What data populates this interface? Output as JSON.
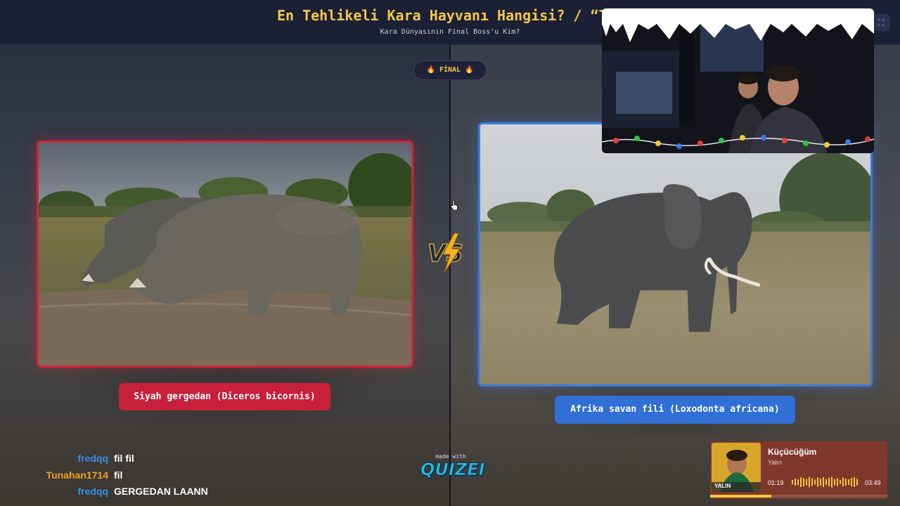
{
  "header": {
    "title": "En Tehlikeli Kara Hayvanı Hangisi? / “Toprak Arena",
    "subtitle": "Kara Dünyasının Final Boss'u Kim?",
    "button_icon": "expand-icon"
  },
  "round_badge": "🔥 FİNAL 🔥",
  "left_option": {
    "label": "Siyah gergedan (Diceros bicornis)",
    "accent": "#d1243b",
    "image": "rhino-photo"
  },
  "right_option": {
    "label": "Afrika savan fili (Loxodonta africana)",
    "accent": "#3d7be0",
    "image": "elephant-photo"
  },
  "vs_icon": "vs-lightning-icon",
  "chat": [
    {
      "user": "fredqq",
      "user_color": "#3a8ee6",
      "message": "fil fil"
    },
    {
      "user": "Tunahan1714",
      "user_color": "#f0a21c",
      "message": "fil"
    },
    {
      "user": "fredqq",
      "user_color": "#3a8ee6",
      "message": "GERGEDAN LAANN"
    }
  ],
  "made_with": {
    "label": "made with",
    "logo": "QUIZEI"
  },
  "music": {
    "title": "Küçücüğüm",
    "artist": "Yalın",
    "elapsed": "01:19",
    "duration": "03:49",
    "progress": 0.345,
    "cover_text": "YALIN"
  }
}
